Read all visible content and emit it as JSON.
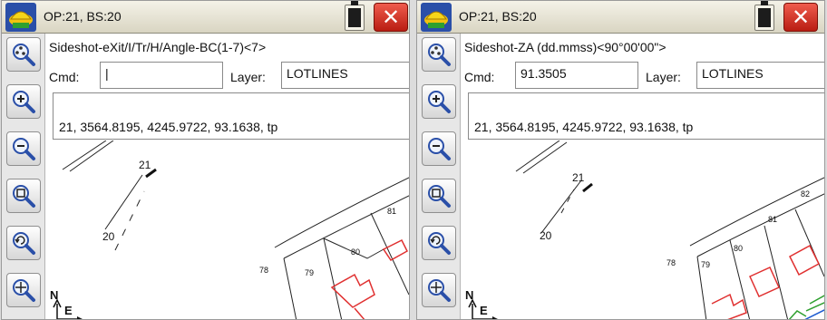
{
  "left_pane": {
    "title": "OP:21, BS:20",
    "prompt": "Sideshot-eXit/I/Tr/H/Angle-BC(1-7)<7>",
    "cmd_label": "Cmd:",
    "cmd_value": "|",
    "layer_label": "Layer:",
    "layer_value": "LOTLINES",
    "output": "21, 3564.8195, 4245.9722, 93.1638, tp",
    "points": [
      "21",
      "20"
    ],
    "lots": [
      "81",
      "80",
      "79",
      "78"
    ],
    "north_label": "N",
    "east_label": "E"
  },
  "right_pane": {
    "title": "OP:21, BS:20",
    "prompt": "Sideshot-ZA (dd.mmss)<90°00'00\">",
    "cmd_label": "Cmd:",
    "cmd_value": "91.3505",
    "layer_label": "Layer:",
    "layer_value": "LOTLINES",
    "output": "21, 3564.8195, 4245.9722, 93.1638, tp",
    "points": [
      "21",
      "20"
    ],
    "lots": [
      "82",
      "81",
      "80",
      "79",
      "78"
    ],
    "north_label": "N",
    "east_label": "E"
  },
  "icons": {
    "close": "✕",
    "app_logo": "hardhat-logo-icon",
    "battery": "battery-icon",
    "toolbar": [
      "zoom-extents-icon",
      "zoom-in-icon",
      "zoom-out-icon",
      "zoom-window-icon",
      "zoom-previous-icon",
      "zoom-center-icon"
    ]
  },
  "colors": {
    "close_red": "#d3271b",
    "lot_red": "#e03030",
    "lot_green": "#2fa030",
    "line_blue": "#1e5bd0"
  }
}
